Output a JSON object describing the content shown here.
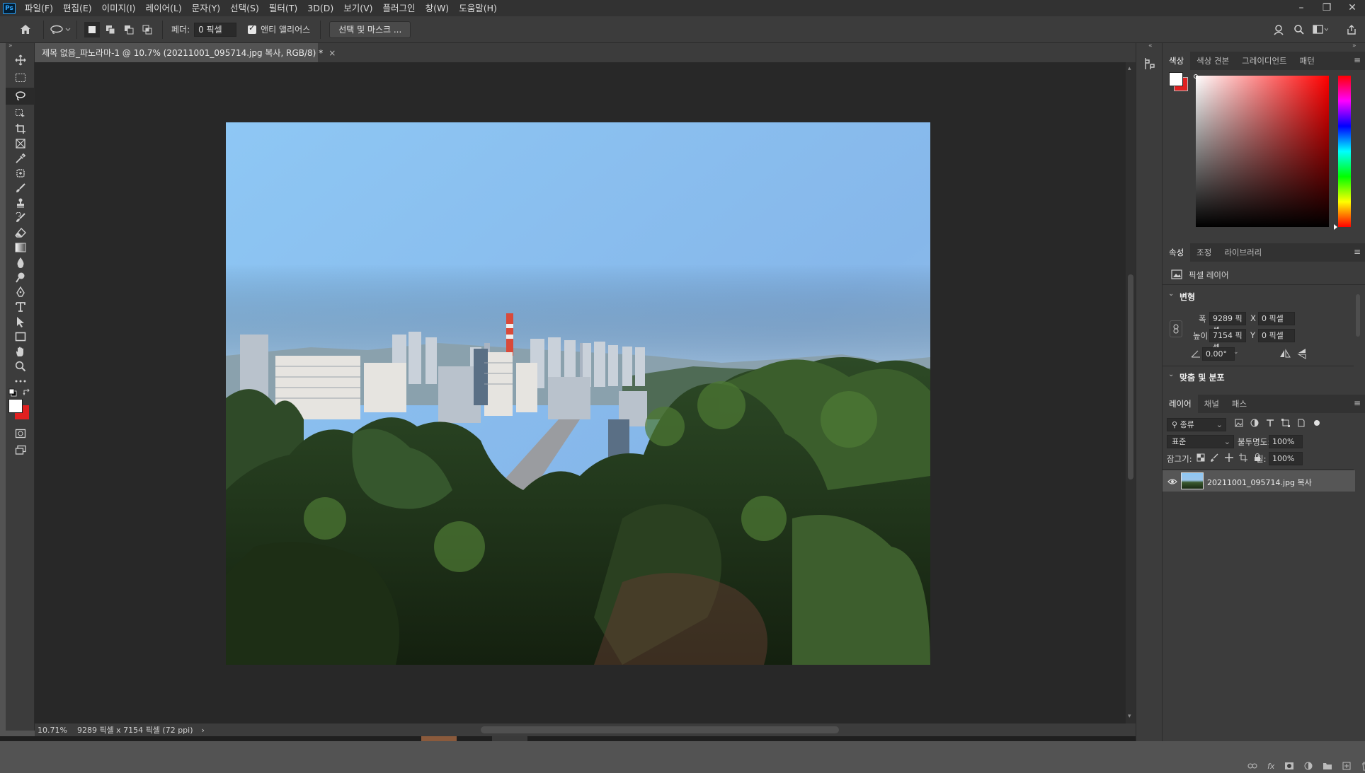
{
  "menubar": {
    "app_logo": "Ps",
    "items": [
      "파일(F)",
      "편집(E)",
      "이미지(I)",
      "레이어(L)",
      "문자(Y)",
      "선택(S)",
      "필터(T)",
      "3D(D)",
      "보기(V)",
      "플러그인",
      "창(W)",
      "도움말(H)"
    ]
  },
  "options_bar": {
    "feather_label": "페더:",
    "feather_value": "0 픽셀",
    "antialias_label": "앤티 앨리어스",
    "antialias_checked": true,
    "select_mask_button": "선택 및 마스크 ..."
  },
  "document": {
    "tab_title": "제목 없음_파노라마-1 @ 10.7% (20211001_095714.jpg 복사, RGB/8) *",
    "tab_close": "×"
  },
  "status_bar": {
    "zoom": "10.71%",
    "doc_info": "9289 픽셀 x 7154 픽셀 (72 ppi)",
    "arrow": "›"
  },
  "color_panel": {
    "tabs": [
      "색상",
      "색상 견본",
      "그레이디언트",
      "패턴"
    ],
    "active_tab": "색상",
    "foreground": "#ffffff",
    "background": "#e02020"
  },
  "properties_panel": {
    "tabs": [
      "속성",
      "조정",
      "라이브러리"
    ],
    "active_tab": "속성",
    "layer_type": "픽셀 레이어",
    "transform_title": "변형",
    "width_label": "폭",
    "width_value": "9289 픽셀",
    "height_label": "높이",
    "height_value": "7154 픽셀",
    "x_label": "X",
    "x_value": "0 픽셀",
    "y_label": "Y",
    "y_value": "0 픽셀",
    "angle_value": "0.00°",
    "align_title": "맞춤 및 분포"
  },
  "layers_panel": {
    "tabs": [
      "레이어",
      "채널",
      "패스"
    ],
    "active_tab": "레이어",
    "filter_kind": "종류",
    "blend_mode": "표준",
    "opacity_label": "불투명도:",
    "opacity_value": "100%",
    "lock_label": "잠그기:",
    "fill_label": "칠:",
    "fill_value": "100%",
    "layers": [
      {
        "name": "20211001_095714.jpg 복사",
        "visible": true,
        "selected": true
      }
    ]
  },
  "colors": {
    "accent": "#31a8ff",
    "canvas_bg": "#282828",
    "panel_bg": "#3c3c3c"
  }
}
